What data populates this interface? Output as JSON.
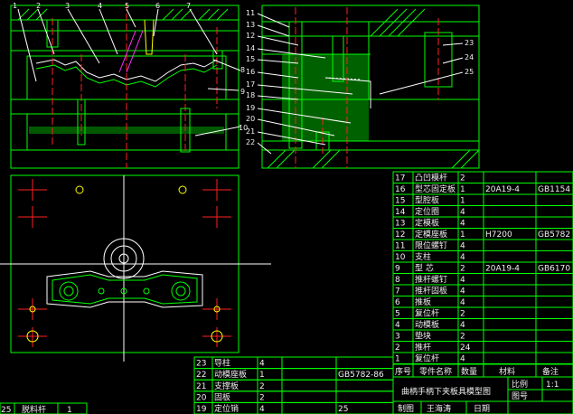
{
  "balloons_left": [
    "1",
    "2",
    "3",
    "4",
    "5",
    "6",
    "7"
  ],
  "balloons_right_upper": [
    "11",
    "13",
    "12",
    "14",
    "15",
    "16",
    "17",
    "18",
    "19",
    "20",
    "21",
    "22"
  ],
  "balloons_right": [
    "23",
    "24",
    "25"
  ],
  "balloons_mid": [
    "8",
    "9",
    "10"
  ],
  "parts_upper": [
    {
      "no": "17",
      "name": "凸凹模杆",
      "qty": "2",
      "material": "",
      "std": ""
    },
    {
      "no": "16",
      "name": "型芯固定板",
      "qty": "1",
      "material": "20A19-4",
      "std": "GB1154"
    },
    {
      "no": "15",
      "name": "型腔板",
      "qty": "1",
      "material": "",
      "std": ""
    },
    {
      "no": "14",
      "name": "定位圈",
      "qty": "4",
      "material": "",
      "std": ""
    },
    {
      "no": "13",
      "name": "定模板",
      "qty": "4",
      "material": "",
      "std": ""
    },
    {
      "no": "12",
      "name": "定模座板",
      "qty": "1",
      "material": "H7200",
      "std": "GB5782"
    },
    {
      "no": "11",
      "name": "限位螺钉",
      "qty": "4",
      "material": "",
      "std": ""
    },
    {
      "no": "10",
      "name": "支柱",
      "qty": "4",
      "material": "",
      "std": ""
    },
    {
      "no": "9",
      "name": "型 芯",
      "qty": "2",
      "material": "20A19-4",
      "std": "GB6170"
    },
    {
      "no": "8",
      "name": "推杆螺钉",
      "qty": "4",
      "material": "",
      "std": ""
    },
    {
      "no": "7",
      "name": "推杆固板",
      "qty": "4",
      "material": "",
      "std": ""
    },
    {
      "no": "6",
      "name": "推板",
      "qty": "4",
      "material": "",
      "std": ""
    },
    {
      "no": "5",
      "name": "复位杆",
      "qty": "2",
      "material": "",
      "std": ""
    },
    {
      "no": "4",
      "name": "动模板",
      "qty": "4",
      "material": "",
      "std": ""
    },
    {
      "no": "3",
      "name": "垫块",
      "qty": "2",
      "material": "",
      "std": ""
    },
    {
      "no": "2",
      "name": "推杆",
      "qty": "24",
      "material": "",
      "std": ""
    },
    {
      "no": "1",
      "name": "复位杆",
      "qty": "4",
      "material": "",
      "std": ""
    }
  ],
  "parts_lower": [
    {
      "no": "23",
      "name": "导柱",
      "qty": "4",
      "material": "",
      "std": ""
    },
    {
      "no": "22",
      "name": "动模座板",
      "qty": "1",
      "material": "",
      "std": "GB5782-86"
    },
    {
      "no": "21",
      "name": "支撑板",
      "qty": "2",
      "material": "",
      "std": ""
    },
    {
      "no": "20",
      "name": "固板",
      "qty": "2",
      "material": "",
      "std": ""
    },
    {
      "no": "19",
      "name": "定位销",
      "qty": "4",
      "material": "",
      "std": "25"
    }
  ],
  "header": {
    "no": "序号",
    "name": "零件名称",
    "qty": "数量",
    "material": "材料",
    "remark": "备注"
  },
  "title_block": {
    "title": "曲柄手柄下夹板具模型图",
    "scale_label": "比例",
    "scale_value": "1:1",
    "drawing_no_label": "图号",
    "drawn_label": "制图",
    "drawer": "王海涛",
    "date_label": "日期"
  },
  "bottom_left": {
    "no": "25",
    "name": "脱料杆",
    "qty": "1"
  }
}
